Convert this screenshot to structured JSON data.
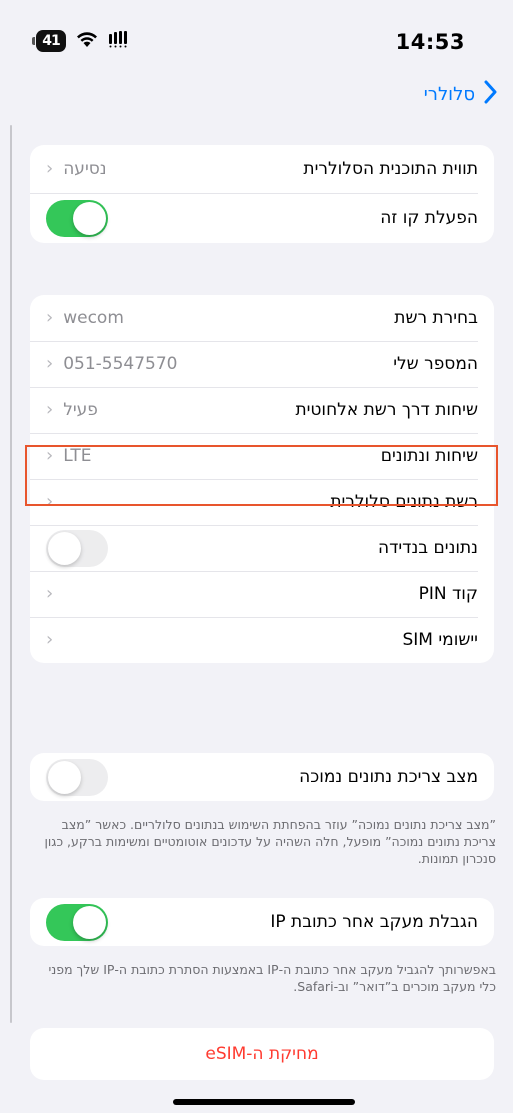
{
  "status_bar": {
    "battery": "41",
    "time": "14:53"
  },
  "nav": {
    "back_label": "סלולרי"
  },
  "plan_card": {
    "label_row": {
      "label": "תווית התוכנית הסלולרית",
      "value": "נסיעה"
    },
    "line_row": {
      "label": "הפעלת קו זה",
      "toggle": "on"
    }
  },
  "network_card": {
    "rows": [
      {
        "label": "בחירת רשת",
        "value": "wecom"
      },
      {
        "label": "המספר שלי",
        "value": "051-5547570"
      },
      {
        "label": "שיחות דרך רשת אלחוטית",
        "value": "פעיל"
      },
      {
        "label": "שיחות ונתונים",
        "value": "LTE"
      },
      {
        "label": "רשת נתונים סלולרית",
        "value": ""
      },
      {
        "label": "נתונים בנדידה",
        "toggle": "off"
      },
      {
        "label": "קוד PIN",
        "value": ""
      },
      {
        "label": "יישומי SIM",
        "value": ""
      }
    ]
  },
  "low_data": {
    "label": "מצב צריכת נתונים נמוכה",
    "toggle": "off",
    "footnote": "”מצב צריכת נתונים נמוכה” עוזר בהפחתת השימוש בנתונים סלולריים. כאשר ”מצב צריכת נתונים נמוכה” מופעל, חלה השהיה על עדכונים אוטומטיים ומשימות ברקע, כגון סנכרון תמונות."
  },
  "ip_tracking": {
    "label": "הגבלת מעקב אחר כתובת IP",
    "toggle": "on",
    "footnote": "באפשרותך להגביל מעקב אחר כתובת ה-IP באמצעות הסתרת כתובת ה-IP שלך מפני כלי מעקב מוכרים ב”דואר” וב-Safari."
  },
  "esim": {
    "label": "מחיקת ה-eSIM"
  },
  "colors": {
    "accent": "#007aff",
    "toggle_on": "#34c759",
    "destructive": "#ff3b30",
    "highlight": "#e8552d"
  }
}
